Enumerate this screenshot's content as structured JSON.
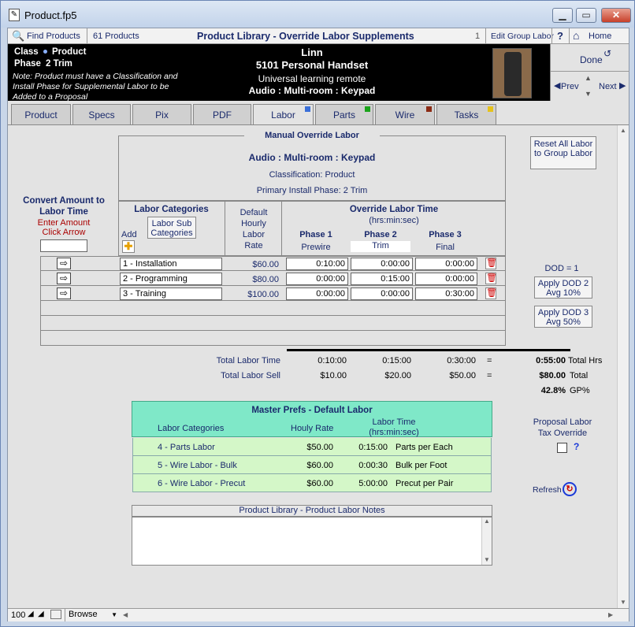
{
  "window": {
    "title": "Product.fp5"
  },
  "toolbar": {
    "find_label": "Find Products",
    "count_label": "61 Products",
    "title": "Product Library - Override Labor Supplements",
    "page_num": "1",
    "edit_group_label": "Edit Group Labor",
    "help_label": "?",
    "home_label": "Home"
  },
  "header": {
    "class_label": "Class",
    "class_value": "Product",
    "phase_label": "Phase",
    "phase_value": "2 Trim",
    "note": "Note: Product must have a Classification and Install Phase for Supplemental Labor to be Added to a Proposal",
    "brand": "Linn",
    "model": "5101 Personal Handset",
    "description": "Universal learning remote",
    "location": "Audio : Multi-room : Keypad",
    "done_label": "Done",
    "prev_label": "Prev",
    "next_label": "Next"
  },
  "tabs": [
    {
      "label": "Product",
      "mark": ""
    },
    {
      "label": "Specs",
      "mark": ""
    },
    {
      "label": "Pix",
      "mark": ""
    },
    {
      "label": "PDF",
      "mark": ""
    },
    {
      "label": "Labor",
      "mark": "#3a6fd8"
    },
    {
      "label": "Parts",
      "mark": "#1aa31a"
    },
    {
      "label": "Wire",
      "mark": "#8b2a14"
    },
    {
      "label": "Tasks",
      "mark": "#e6c21a"
    }
  ],
  "labor": {
    "section_title": "Manual Override Labor",
    "location": "Audio : Multi-room : Keypad",
    "classification": "Classification: Product",
    "primary_phase": "Primary Install Phase: 2 Trim",
    "reset_label": "Reset All Labor to Group Labor",
    "convert_title": "Convert Amount to Labor Time",
    "convert_hint": "Enter Amount Click Arrow",
    "categories_header": "Labor Categories",
    "sub_categories_label": "Labor Sub Categories",
    "add_label": "Add",
    "rate_header": "Default Hourly Labor Rate",
    "override_header": "Override Labor Time",
    "override_sub": "(hrs:min:sec)",
    "phases": [
      {
        "title": "Phase 1",
        "name": "Prewire"
      },
      {
        "title": "Phase 2",
        "name": "Trim"
      },
      {
        "title": "Phase 3",
        "name": "Final"
      }
    ],
    "rows": [
      {
        "category": "1 - Installation",
        "rate": "$60.00",
        "p1": "0:10:00",
        "p2": "0:00:00",
        "p3": "0:00:00"
      },
      {
        "category": "2 - Programming",
        "rate": "$80.00",
        "p1": "0:00:00",
        "p2": "0:15:00",
        "p3": "0:00:00"
      },
      {
        "category": "3 - Training",
        "rate": "$100.00",
        "p1": "0:00:00",
        "p2": "0:00:00",
        "p3": "0:30:00"
      }
    ],
    "dod_label": "DOD = 1",
    "dod2_label": "Apply DOD 2 Avg 10%",
    "dod3_label": "Apply DOD 3 Avg 50%",
    "totals": {
      "time_label": "Total Labor Time",
      "time_p1": "0:10:00",
      "time_p2": "0:15:00",
      "time_p3": "0:30:00",
      "eq1": "=",
      "time_total": "0:55:00",
      "time_unit": "Total Hrs",
      "sell_label": "Total Labor Sell",
      "sell_p1": "$10.00",
      "sell_p2": "$20.00",
      "sell_p3": "$50.00",
      "eq2": "=",
      "sell_total": "$80.00",
      "sell_unit": "Total",
      "gp_value": "42.8%",
      "gp_unit": "GP%"
    }
  },
  "master": {
    "title": "Master Prefs - Default Labor",
    "col_category": "Labor Categories",
    "col_rate": "Houly Rate",
    "col_time": "Labor Time",
    "col_time_sub": "(hrs:min:sec)",
    "rows": [
      {
        "category": "4 - Parts Labor",
        "rate": "$50.00",
        "time": "0:15:00",
        "unit": "Parts per Each"
      },
      {
        "category": "5 - Wire Labor - Bulk",
        "rate": "$60.00",
        "time": "0:00:30",
        "unit": "Bulk per Foot"
      },
      {
        "category": "6 - Wire Labor - Precut",
        "rate": "$60.00",
        "time": "5:00:00",
        "unit": "Precut per Pair"
      }
    ]
  },
  "tax": {
    "label": "Proposal Labor Tax Override",
    "help": "?",
    "refresh_label": "Refresh"
  },
  "notes": {
    "title": "Product Library  - Product Labor Notes"
  },
  "statusbar": {
    "zoom": "100",
    "mode": "Browse"
  }
}
